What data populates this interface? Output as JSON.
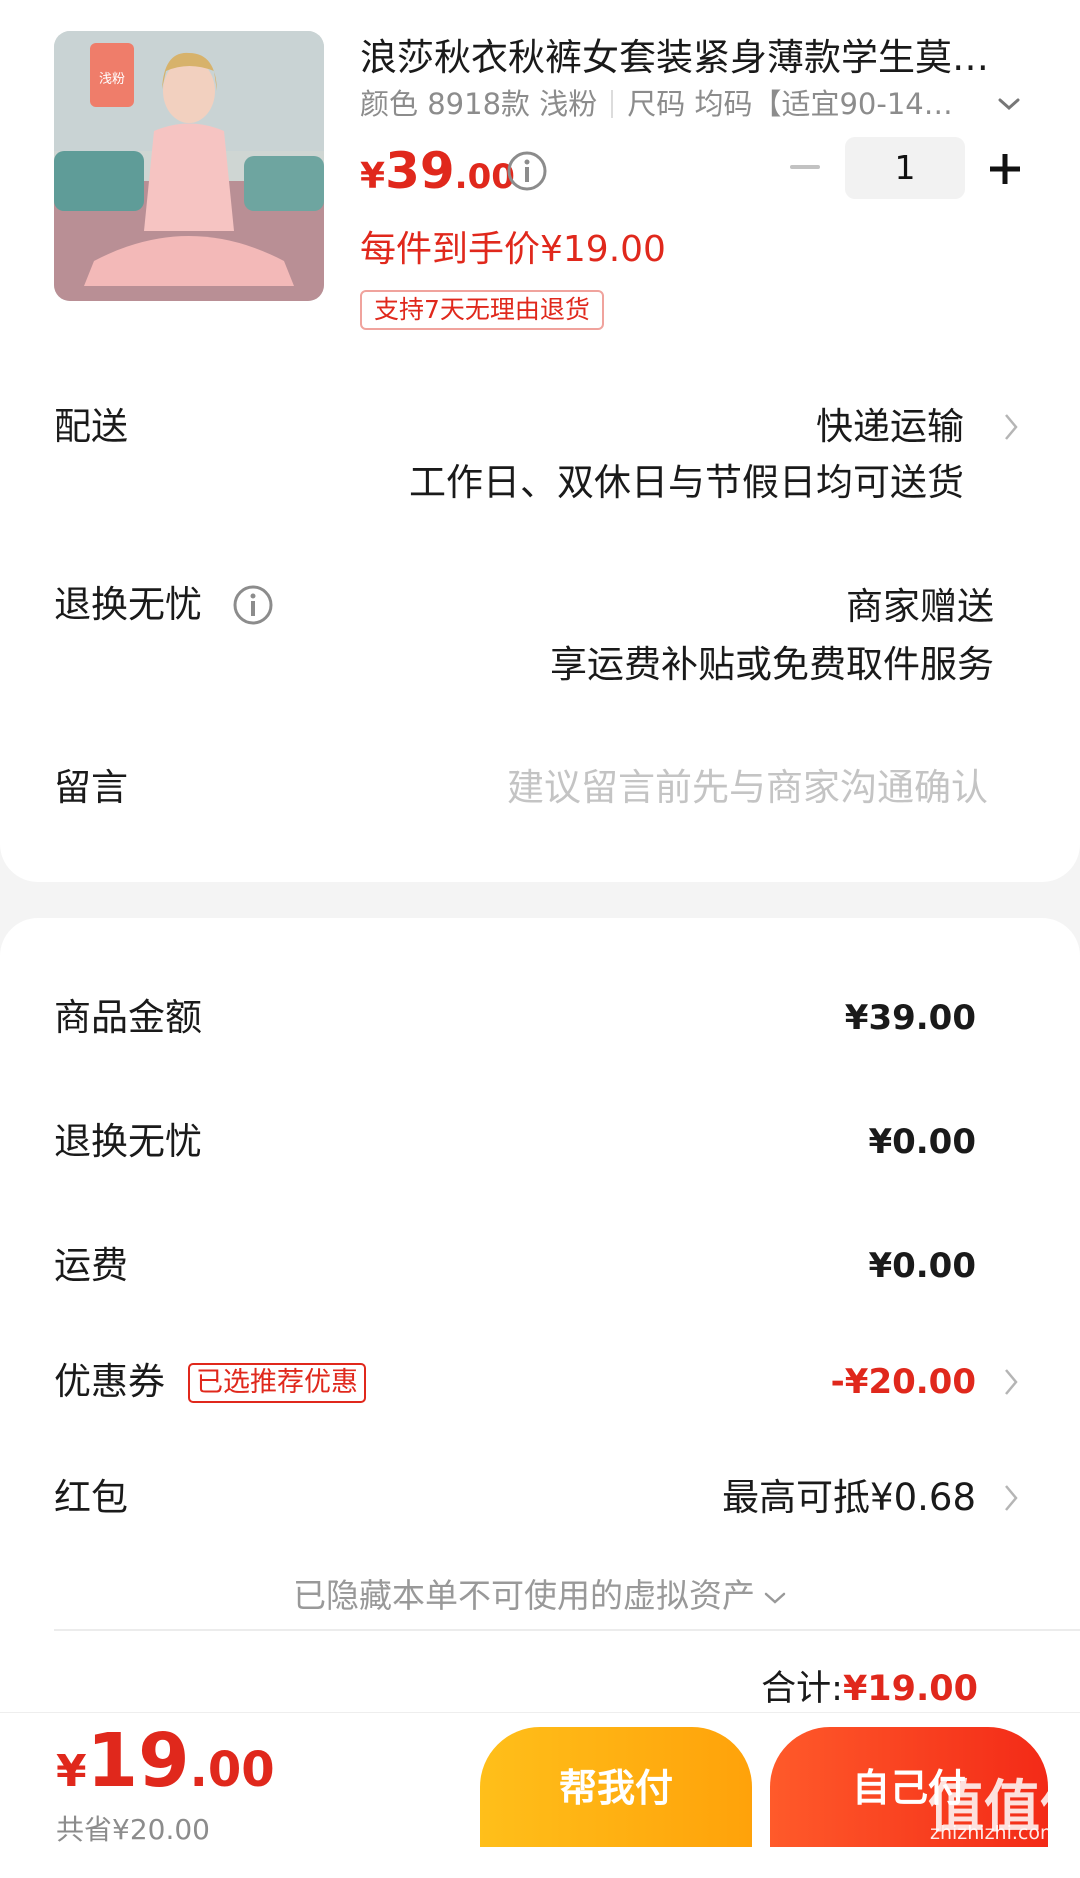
{
  "product": {
    "thumb_tag": "浅粉",
    "title": "浪莎秋衣秋裤女套装紧身薄款学生莫…",
    "spec_color": "颜色 8918款 浅粉",
    "spec_size": "尺码 均码【适宜90-14…",
    "price_symbol": "¥",
    "price_int": "39",
    "price_dec": ".00",
    "quantity": "1",
    "each_price": "每件到手价¥19.00",
    "return_tag": "支持7天无理由退货"
  },
  "delivery": {
    "label": "配送",
    "method": "快递运输",
    "note": "工作日、双休日与节假日均可送货"
  },
  "worry_free": {
    "label": "退换无忧",
    "value": "商家赠送",
    "note": "享运费补贴或免费取件服务"
  },
  "message": {
    "label": "留言",
    "placeholder": "建议留言前先与商家沟通确认"
  },
  "summary": {
    "goods_label": "商品金额",
    "goods_value": "¥39.00",
    "worry_label": "退换无忧",
    "worry_value": "¥0.00",
    "shipping_label": "运费",
    "shipping_value": "¥0.00",
    "coupon_label": "优惠券",
    "coupon_tag": "已选推荐优惠",
    "coupon_value": "-¥20.00",
    "redpacket_label": "红包",
    "redpacket_value": "最高可抵¥0.68",
    "hidden_assets": "已隐藏本单不可使用的虚拟资产",
    "total_label": "合计:",
    "total_value": "¥19.00"
  },
  "bottom_bar": {
    "price_symbol": "¥",
    "price_int": "19",
    "price_dec": ".00",
    "saved": "共省¥20.00",
    "help_pay": "帮我付",
    "self_pay": "自己付"
  },
  "watermark": {
    "logo": "值值值",
    "url": "zhizhizhi.com"
  },
  "colors": {
    "accent_red": "#e0281c",
    "help_button": "#ffb013",
    "self_button": "#f53b1e"
  }
}
